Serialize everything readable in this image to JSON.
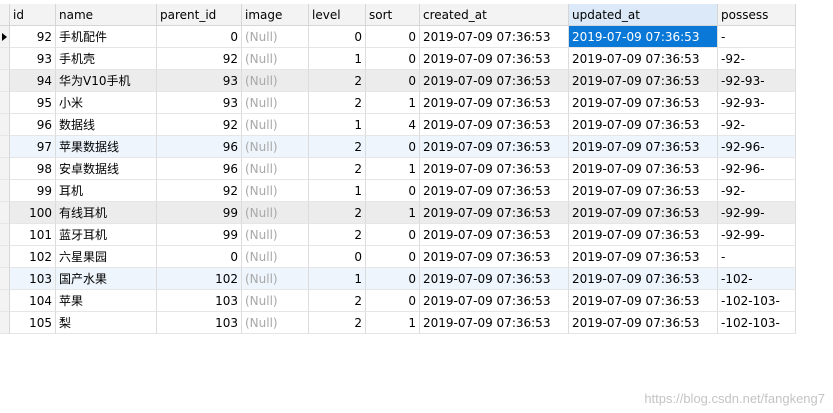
{
  "columns": [
    "id",
    "name",
    "parent_id",
    "image",
    "level",
    "sort",
    "created_at",
    "updated_at",
    "possess"
  ],
  "rows": [
    {
      "id": "92",
      "name": "手机配件",
      "parent_id": "0",
      "image": "(Null)",
      "level": "0",
      "sort": "0",
      "created_at": "2019-07-09 07:36:53",
      "updated_at": "2019-07-09 07:36:53",
      "possess": "-"
    },
    {
      "id": "93",
      "name": "手机壳",
      "parent_id": "92",
      "image": "(Null)",
      "level": "1",
      "sort": "0",
      "created_at": "2019-07-09 07:36:53",
      "updated_at": "2019-07-09 07:36:53",
      "possess": "-92-"
    },
    {
      "id": "94",
      "name": "华为V10手机",
      "parent_id": "93",
      "image": "(Null)",
      "level": "2",
      "sort": "0",
      "created_at": "2019-07-09 07:36:53",
      "updated_at": "2019-07-09 07:36:53",
      "possess": "-92-93-"
    },
    {
      "id": "95",
      "name": "小米",
      "parent_id": "93",
      "image": "(Null)",
      "level": "2",
      "sort": "1",
      "created_at": "2019-07-09 07:36:53",
      "updated_at": "2019-07-09 07:36:53",
      "possess": "-92-93-"
    },
    {
      "id": "96",
      "name": "数据线",
      "parent_id": "92",
      "image": "(Null)",
      "level": "1",
      "sort": "4",
      "created_at": "2019-07-09 07:36:53",
      "updated_at": "2019-07-09 07:36:53",
      "possess": "-92-"
    },
    {
      "id": "97",
      "name": "苹果数据线",
      "parent_id": "96",
      "image": "(Null)",
      "level": "2",
      "sort": "0",
      "created_at": "2019-07-09 07:36:53",
      "updated_at": "2019-07-09 07:36:53",
      "possess": "-92-96-"
    },
    {
      "id": "98",
      "name": "安卓数据线",
      "parent_id": "96",
      "image": "(Null)",
      "level": "2",
      "sort": "1",
      "created_at": "2019-07-09 07:36:53",
      "updated_at": "2019-07-09 07:36:53",
      "possess": "-92-96-"
    },
    {
      "id": "99",
      "name": "耳机",
      "parent_id": "92",
      "image": "(Null)",
      "level": "1",
      "sort": "0",
      "created_at": "2019-07-09 07:36:53",
      "updated_at": "2019-07-09 07:36:53",
      "possess": "-92-"
    },
    {
      "id": "100",
      "name": "有线耳机",
      "parent_id": "99",
      "image": "(Null)",
      "level": "2",
      "sort": "1",
      "created_at": "2019-07-09 07:36:53",
      "updated_at": "2019-07-09 07:36:53",
      "possess": "-92-99-"
    },
    {
      "id": "101",
      "name": "蓝牙耳机",
      "parent_id": "99",
      "image": "(Null)",
      "level": "2",
      "sort": "0",
      "created_at": "2019-07-09 07:36:53",
      "updated_at": "2019-07-09 07:36:53",
      "possess": "-92-99-"
    },
    {
      "id": "102",
      "name": "六星果园",
      "parent_id": "0",
      "image": "(Null)",
      "level": "0",
      "sort": "0",
      "created_at": "2019-07-09 07:36:53",
      "updated_at": "2019-07-09 07:36:53",
      "possess": "-"
    },
    {
      "id": "103",
      "name": "国产水果",
      "parent_id": "102",
      "image": "(Null)",
      "level": "1",
      "sort": "0",
      "created_at": "2019-07-09 07:36:53",
      "updated_at": "2019-07-09 07:36:53",
      "possess": "-102-"
    },
    {
      "id": "104",
      "name": "苹果",
      "parent_id": "103",
      "image": "(Null)",
      "level": "2",
      "sort": "0",
      "created_at": "2019-07-09 07:36:53",
      "updated_at": "2019-07-09 07:36:53",
      "possess": "-102-103-"
    },
    {
      "id": "105",
      "name": "梨",
      "parent_id": "103",
      "image": "(Null)",
      "level": "2",
      "sort": "1",
      "created_at": "2019-07-09 07:36:53",
      "updated_at": "2019-07-09 07:36:53",
      "possess": "-102-103-"
    }
  ],
  "selected_column": "updated_at",
  "row_shading": [
    "none",
    "none",
    "gray",
    "none",
    "none",
    "blue",
    "none",
    "none",
    "gray",
    "none",
    "none",
    "blue",
    "none",
    "none"
  ],
  "current_row_marker_icon": "row-pointer-icon",
  "watermark": "https://blog.csdn.net/fangkeng7",
  "colors": {
    "selection": "#0a78d7",
    "null_text": "#a8a8a8",
    "header_bg": "#f3f3f3"
  }
}
